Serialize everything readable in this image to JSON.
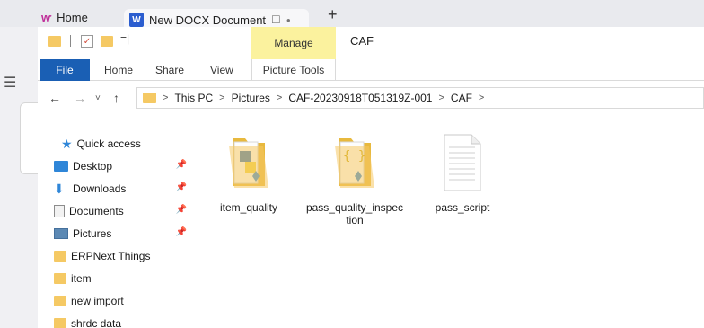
{
  "browser": {
    "tabs": [
      {
        "label": "Home"
      },
      {
        "label": "New DOCX Document"
      }
    ],
    "word_badge": "W",
    "new_tab_symbol": "+",
    "tab_box_symbol": "☐",
    "tab_dot_symbol": "●"
  },
  "qat": {
    "dropdown_symbol": "=|"
  },
  "window": {
    "title": "CAF",
    "manage_label": "Manage"
  },
  "ribbon": {
    "tabs": [
      {
        "label": "File"
      },
      {
        "label": "Home"
      },
      {
        "label": "Share"
      },
      {
        "label": "View"
      },
      {
        "label": "Picture Tools"
      }
    ]
  },
  "address": {
    "breadcrumbs": [
      "This PC",
      "Pictures",
      "CAF-20230918T051319Z-001",
      "CAF"
    ],
    "separator": ">"
  },
  "navigation": {
    "quick_access": "Quick access",
    "items": [
      {
        "label": "Desktop",
        "icon": "desktop-icon",
        "pinned": true
      },
      {
        "label": "Downloads",
        "icon": "downloads-icon",
        "pinned": true
      },
      {
        "label": "Documents",
        "icon": "documents-icon",
        "pinned": true
      },
      {
        "label": "Pictures",
        "icon": "pictures-icon",
        "pinned": true
      },
      {
        "label": "ERPNext Things",
        "icon": "folder-icon",
        "pinned": false
      },
      {
        "label": "item",
        "icon": "folder-icon",
        "pinned": false
      },
      {
        "label": "new import",
        "icon": "folder-icon",
        "pinned": false
      },
      {
        "label": "shrdc data",
        "icon": "folder-icon",
        "pinned": false
      }
    ]
  },
  "files": [
    {
      "name": "item_quality",
      "type": "folder",
      "icon": "python-folder-icon"
    },
    {
      "name": "pass_quality_inspection",
      "type": "folder",
      "icon": "json-folder-icon"
    },
    {
      "name": "pass_script",
      "type": "file",
      "icon": "text-file-icon"
    }
  ],
  "colors": {
    "file_tab": "#1a5fb4",
    "manage_tab": "#fbf29e",
    "folder": "#f5c964",
    "accent_blue": "#2f86d8"
  }
}
